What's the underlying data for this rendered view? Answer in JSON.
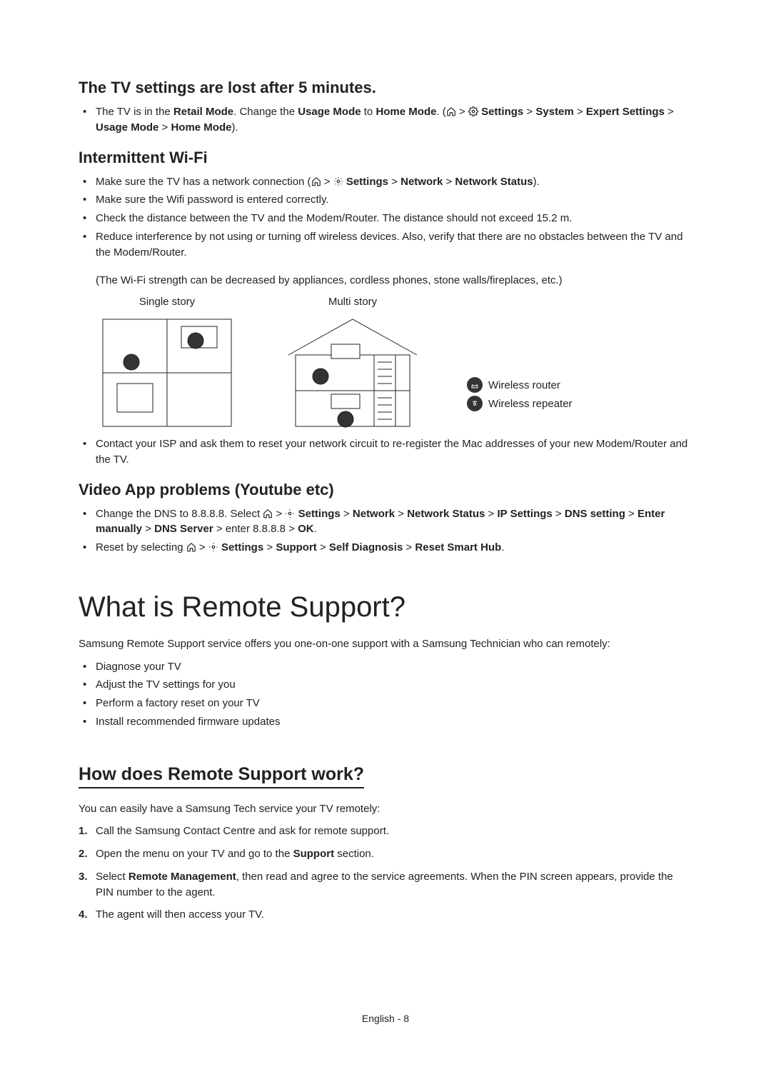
{
  "section_tv_lost": {
    "title": "The TV settings are lost after 5 minutes.",
    "bullet_prefix": "The TV is in the ",
    "bold1": "Retail Mode",
    "mid1": ". Change the ",
    "bold2": "Usage Mode",
    "mid2": " to ",
    "bold3": "Home Mode",
    "mid3": ". (",
    "path_prefix": " ",
    "path_settings": "Settings",
    "path_system": "System",
    "path_expert": "Expert Settings",
    "path_usage": "Usage Mode",
    "path_home": "Home Mode",
    "suffix": ")."
  },
  "section_wifi": {
    "title": "Intermittent Wi-Fi",
    "b1_prefix": "Make sure the TV has a network connection (",
    "b1_settings": "Settings",
    "b1_network": "Network",
    "b1_status": "Network Status",
    "b1_suffix": ").",
    "b2": "Make sure the Wifi password is entered correctly.",
    "b3": "Check the distance between the TV and the Modem/Router. The distance should not exceed 15.2 m.",
    "b4": "Reduce interference by not using or turning off wireless devices. Also, verify that there are no obstacles between the TV and the Modem/Router.",
    "note": "(The Wi-Fi strength can be decreased by appliances, cordless phones, stone walls/fireplaces, etc.)",
    "fig1_label": "Single story",
    "fig2_label": "Multi story",
    "legend1": "Wireless router",
    "legend2": "Wireless repeater",
    "b5": "Contact your ISP and ask them to reset your network circuit to re-register the Mac addresses of your new Modem/Router and the TV."
  },
  "section_video": {
    "title": "Video App problems (Youtube etc)",
    "b1_prefix": "Change the DNS to 8.8.8.8. Select ",
    "p_settings": "Settings",
    "p_network": "Network",
    "p_status": "Network Status",
    "p_ip": "IP Settings",
    "p_dns": "DNS setting",
    "p_enter": "Enter manually",
    "p_server": "DNS Server",
    "b1_mid": " enter 8.8.8.8 ",
    "p_ok": "OK",
    "b2_prefix": "Reset by selecting ",
    "p2_settings": "Settings",
    "p2_support": "Support",
    "p2_diag": "Self Diagnosis",
    "p2_reset": "Reset Smart Hub"
  },
  "section_remote": {
    "title": "What is Remote Support?",
    "intro": "Samsung Remote Support service offers you one-on-one support with a Samsung Technician who can remotely:",
    "b1": "Diagnose your TV",
    "b2": "Adjust the TV settings for you",
    "b3": "Perform a factory reset on your TV",
    "b4": "Install recommended firmware updates"
  },
  "section_how": {
    "title": "How does Remote Support work?",
    "intro": "You can easily have a Samsung Tech service your TV remotely:",
    "s1": "Call the Samsung Contact Centre and ask for remote support.",
    "s2_prefix": "Open the menu on your TV and go to the ",
    "s2_bold": "Support",
    "s2_suffix": " section.",
    "s3_prefix": "Select ",
    "s3_bold": "Remote Management",
    "s3_suffix": ", then read and agree to the service agreements. When the PIN screen appears, provide the PIN number to the agent.",
    "s4": "The agent will then access your TV."
  },
  "footer": {
    "lang": "English",
    "sep": " - ",
    "page": "8"
  },
  "sep": " > "
}
